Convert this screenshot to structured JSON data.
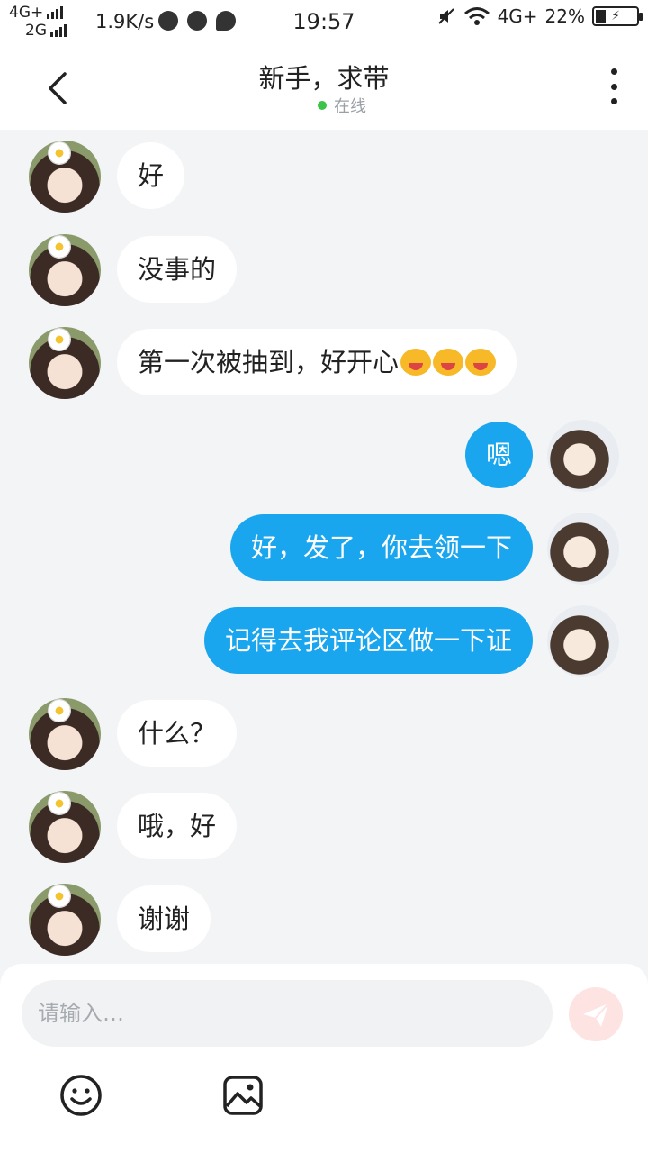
{
  "status_bar": {
    "net_top": "4G+",
    "net_bottom": "2G",
    "speed": "1.9K/s",
    "time": "19:57",
    "net_right": "4G+",
    "battery": "22%"
  },
  "header": {
    "title": "新手，求带",
    "status": "在线"
  },
  "messages": [
    {
      "side": "left",
      "text": "好"
    },
    {
      "side": "left",
      "text": "没事的"
    },
    {
      "side": "left",
      "text": "第一次被抽到，好开心"
    },
    {
      "side": "right",
      "text": "嗯"
    },
    {
      "side": "right",
      "text": "好，发了，你去领一下"
    },
    {
      "side": "right",
      "text": "记得去我评论区做一下证"
    },
    {
      "side": "left",
      "text": "什么？"
    },
    {
      "side": "left",
      "text": "哦，好"
    },
    {
      "side": "left",
      "text": "谢谢"
    }
  ],
  "input": {
    "placeholder": "请输入…"
  },
  "icons": {
    "back": "chevron-left-icon",
    "more": "more-vertical-icon",
    "send": "paper-plane-icon",
    "emoji": "smiley-icon",
    "image": "image-icon",
    "emoji_inline": "laughing-emoji-icon"
  },
  "colors": {
    "accent": "#1aa6ee",
    "online": "#3cc34a",
    "send_disabled": "#fde3e1"
  }
}
